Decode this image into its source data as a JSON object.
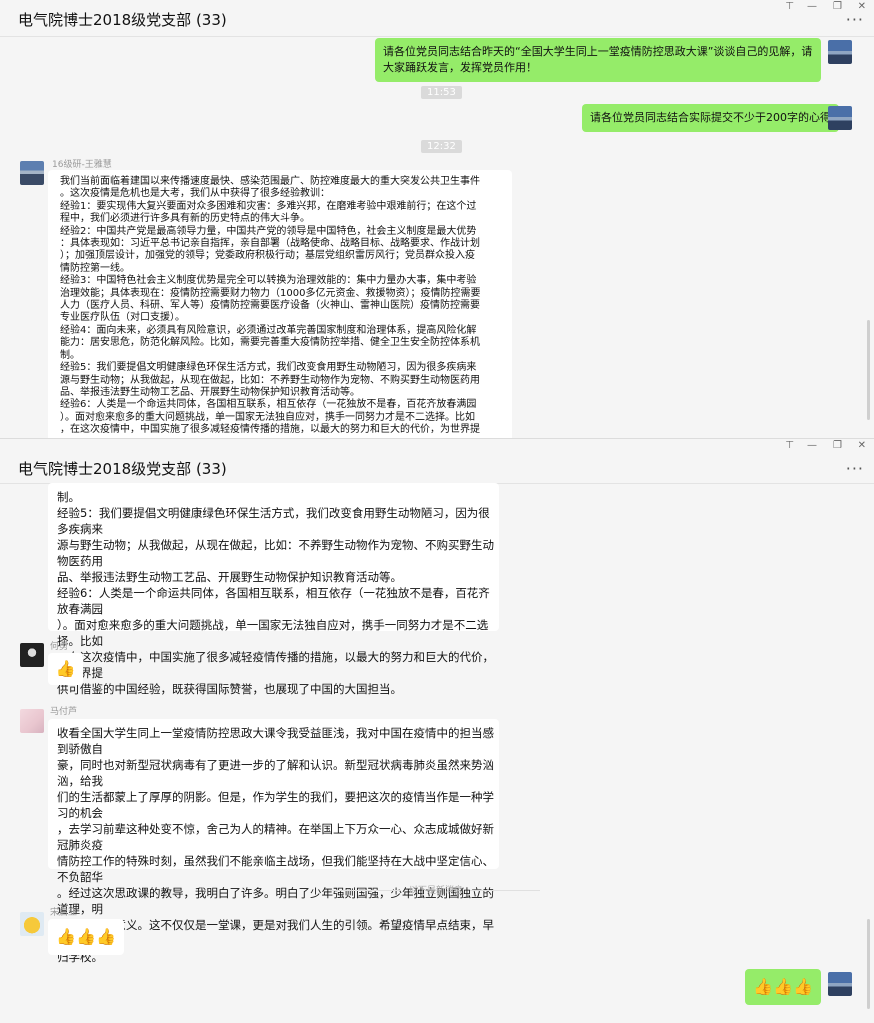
{
  "window_controls": {
    "pin": "⊤",
    "minimize": "—",
    "restore": "❐",
    "close": "✕"
  },
  "chat_title": "电气院博士2018级党支部 (33)",
  "more_label": "···",
  "top_window": {
    "msg1": "请各位党员同志结合昨天的“全国大学生同上一堂疫情防控思政大课”谈谈自己的见解，请大家踊跃发言，发挥党员作用！",
    "time1": "11:53",
    "msg2": "请各位党员同志结合实际提交不少于200字的心得",
    "time2": "12:32",
    "sender": "16级研-王雅慧",
    "long_msg": [
      "我们当前面临着建国以来传播速度最快、感染范围最广、防控难度最大的重大突发公共卫生事件",
      "。这次疫情是危机也是大考，我们从中获得了很多经验教训：",
      "经验1：要实现伟大复兴要面对众多困难和灾害：多难兴邦，在磨难考验中艰难前行；在这个过",
      "程中，我们必须进行许多具有新的历史特点的伟大斗争。",
      "经验2：中国共产党是最高领导力量，中国共产党的领导是中国特色，社会主义制度是最大优势",
      "：具体表现如：习近平总书记亲自指挥，亲自部署（战略使命、战略目标、战略要求、作战计划",
      "）；加强顶层设计，加强党的领导；党委政府积极行动；基层党组织雷厉风行；党员群众投入疫",
      "情防控第一线。",
      "经验3：中国特色社会主义制度优势是完全可以转换为治理效能的：集中力量办大事，集中考验",
      "治理效能；具体表现在：疫情防控需要财力物力（1000多亿元资金、救援物资）；疫情防控需要",
      "人力（医疗人员、科研、军人等）疫情防控需要医疗设备（火神山、雷神山医院）疫情防控需要",
      "专业医疗队伍（对口支援）。",
      "经验4：面向未来，必须具有风险意识，必须通过改革完善国家制度和治理体系，提高风险化解",
      "能力：居安思危，防范化解风险。比如，需要完善重大疫情防控举措、健全卫生安全防控体系机",
      "制。",
      "经验5：我们要提倡文明健康绿色环保生活方式，我们改变食用野生动物陋习，因为很多疾病来",
      "源与野生动物；从我做起，从现在做起，比如：不养野生动物作为宠物、不购买野生动物医药用",
      "品、举报违法野生动物工艺品、开展野生动物保护知识教育活动等。",
      "经验6：人类是一个命运共同体，各国相互联系，相互依存（一花独放不是春，百花齐放春满园",
      "）。面对愈来愈多的重大问题挑战，单一国家无法独自应对，携手一同努力才是不二选择。比如",
      "，在这次疫情中，中国实施了很多减轻疫情传播的措施，以最大的努力和巨大的代价，为世界提"
    ]
  },
  "bottom_window": {
    "cont_msg": [
      "制。",
      "经验5：我们要提倡文明健康绿色环保生活方式，我们改变食用野生动物陋习，因为很多疾病来",
      "源与野生动物；从我做起，从现在做起，比如：不养野生动物作为宠物、不购买野生动物医药用",
      "品、举报违法野生动物工艺品、开展野生动物保护知识教育活动等。",
      "经验6：人类是一个命运共同体，各国相互联系，相互依存（一花独放不是春，百花齐放春满园",
      "）。面对愈来愈多的重大问题挑战，单一国家无法独自应对，携手一同努力才是不二选择。比如",
      "，在这次疫情中，中国实施了很多减轻疫情传播的措施，以最大的努力和巨大的代价，为世界提",
      "供可借鉴的中国经验，既获得国际赞誉，也展现了中国的大国担当。"
    ],
    "sender_he": "何勇",
    "thumb1": "👍",
    "sender_ma": "马付芦",
    "ma_msg": [
      "收看全国大学生同上一堂疫情防控思政大课令我受益匪浅，我对中国在疫情中的担当感到骄傲自",
      "豪，同时也对新型冠状病毒有了更进一步的了解和认识。新型冠状病毒肺炎虽然来势汹汹，给我",
      "们的生活都蒙上了厚厚的阴影。但是，作为学生的我们，要把这次的疫情当作是一种学习的机会",
      "，去学习前辈这种处变不惊，舍己为人的精神。在举国上下万众一心、众志成城做好新冠肺炎疫",
      "情防控工作的特殊时刻，虽然我们不能亲临主战场，但我们能坚持在大战中坚定信心、不负韶华",
      "。经过这次思政课的教导，我明白了许多。明白了少年强则国强，少年独立则国独立的道理，明",
      "白了爱国的意义。这不仅仅是一堂课，更是对我们人生的引领。希望疫情早点结束，早点能够回",
      "归学校。"
    ],
    "new_msg_sep": "以下是新消息",
    "sender_song": "宋启亚",
    "thumb3": "👍👍👍",
    "my_thumb3": "👍👍👍"
  }
}
